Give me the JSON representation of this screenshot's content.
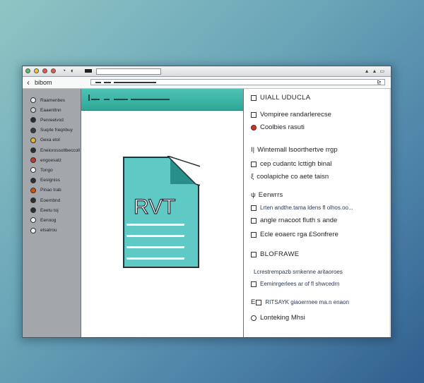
{
  "window": {
    "back_label": "‹",
    "breadcrumb": "bibom",
    "search_button": "⊵",
    "titlebar_right": "▲ ▲ ▭"
  },
  "sidebar": {
    "items": [
      {
        "label": "Raamenbes",
        "icon": "circle-icon",
        "color": "#e8e8e8"
      },
      {
        "label": "Eaaenttnn",
        "icon": "gear-icon",
        "color": "#d0d0d0"
      },
      {
        "label": "Penreelvod",
        "icon": "circle-icon",
        "color": "#2b2b2b"
      },
      {
        "label": "Suqrle freqnbuy",
        "icon": "circle-icon",
        "color": "#3a3a3a"
      },
      {
        "label": "Gexa etol",
        "icon": "circle-icon",
        "color": "#e2b23a"
      },
      {
        "label": "Eneiorossotlbeccoll",
        "icon": "circle-icon",
        "color": "#2d2d2d"
      },
      {
        "label": "engoesatz",
        "icon": "circle-icon",
        "color": "#c0392b"
      },
      {
        "label": "Tongo",
        "icon": "circle-icon",
        "color": "#f0f0f0"
      },
      {
        "label": "Eesigniss",
        "icon": "circle-icon",
        "color": "#2d2d2d"
      },
      {
        "label": "Pinao trab",
        "icon": "circle-icon",
        "color": "#d35400"
      },
      {
        "label": "Eoernbnd",
        "icon": "circle-icon",
        "color": "#2d2d2d"
      },
      {
        "label": "Eeetu toj",
        "icon": "circle-icon",
        "color": "#2d2d2d"
      },
      {
        "label": "Eenoog",
        "icon": "circle-icon",
        "color": "#f0f0f0"
      },
      {
        "label": "etsatrou",
        "icon": "gear-icon",
        "color": "#f0f0f0"
      }
    ]
  },
  "file_preview": {
    "label": "RVT",
    "fill": "#5fc9c6",
    "stroke": "#263238"
  },
  "details": {
    "rows": [
      {
        "icon": "square",
        "text": "UIALL UDUCLA",
        "style": "r-head"
      },
      {
        "icon": "square",
        "text": "Vompiree randarlerecse",
        "style": "r-text"
      },
      {
        "icon": "red",
        "text": "Coolbies rasuti",
        "style": "r-text"
      },
      {
        "icon": "none",
        "text": "Wintemall lsoorthertve rrgp",
        "style": "r-text",
        "prefix": "I|"
      },
      {
        "icon": "square",
        "text": "cep cudantc lcttigh binal",
        "style": "r-text"
      },
      {
        "icon": "none",
        "text": "coolapiche co aete taisn",
        "style": "r-text",
        "prefix": "ξ"
      },
      {
        "icon": "none",
        "text": "Eerwrrs",
        "style": "r-head",
        "prefix": "ψ"
      },
      {
        "icon": "square",
        "text": "Lrten andthe.tama ldens fl olhos.oo...",
        "style": "r-small"
      },
      {
        "icon": "square",
        "text": "angle rnacoot fluth s ande",
        "style": "r-text"
      },
      {
        "icon": "square",
        "text": "Ecle eoaerc rga £Sonfrere",
        "style": "r-text"
      },
      {
        "icon": "square",
        "text": "BLOFRAWE",
        "style": "r-head"
      },
      {
        "icon": "none",
        "text": "Lcrestrempazb srnkenne aritaoroes",
        "style": "r-small"
      },
      {
        "icon": "square",
        "text": "Eeminrgerlees ar of fl shwcedrn",
        "style": "r-small"
      },
      {
        "icon": "square",
        "text": "RITSAYK giaoerrnee ma.n enaon",
        "style": "r-small",
        "prefix": "E"
      },
      {
        "icon": "round",
        "text": "Lonteking Mhsi",
        "style": "r-text"
      }
    ]
  }
}
